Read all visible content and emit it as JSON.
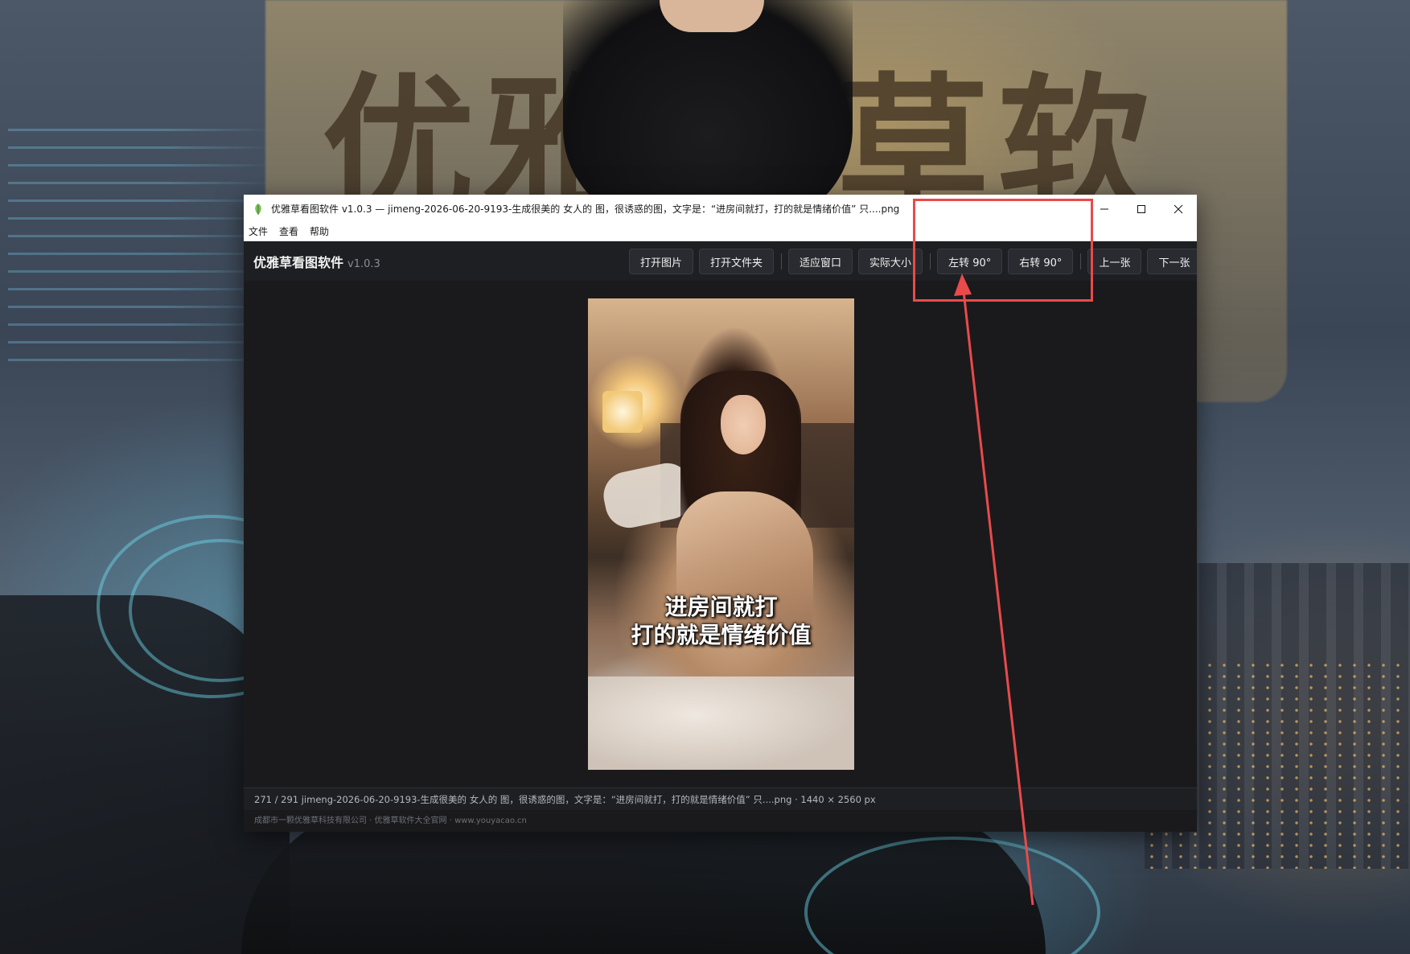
{
  "window": {
    "title": "优雅草看图软件 v1.0.3 — jimeng-2026-06-20-9193-生成很美的 女人的 图，很诱惑的图，文字是：“进房间就打，打的就是情绪价值” 只....png",
    "controls": {
      "minimize": "—",
      "maximize": "☐",
      "close": "✕"
    }
  },
  "menubar": {
    "items": [
      "文件",
      "查看",
      "帮助"
    ]
  },
  "toolbar": {
    "brand": "优雅草看图软件",
    "version": "v1.0.3",
    "buttons": {
      "open_image": "打开图片",
      "open_folder": "打开文件夹",
      "fit_window": "适应窗口",
      "actual_size": "实际大小",
      "rotate_left": "左转 90°",
      "rotate_right": "右转 90°",
      "prev": "上一张",
      "next": "下一张"
    }
  },
  "image": {
    "caption_line1": "进房间就打",
    "caption_line2": "打的就是情绪价值"
  },
  "status": {
    "text": "271 / 291  jimeng-2026-06-20-9193-生成很美的 女人的 图，很诱惑的图，文字是：“进房间就打，打的就是情绪价值” 只....png · 1440 × 2560 px"
  },
  "footer": {
    "text": "成都市一颗优雅草科技有限公司 · 优雅草软件大全官网 · www.youyacao.cn"
  },
  "wallpaper": {
    "calligraphy_left": "优雅",
    "calligraphy_right": "草软"
  },
  "colors": {
    "annotation": "#ea4a4a",
    "toolbar_bg": "#1e1f23",
    "viewer_bg": "#1a1a1d"
  }
}
